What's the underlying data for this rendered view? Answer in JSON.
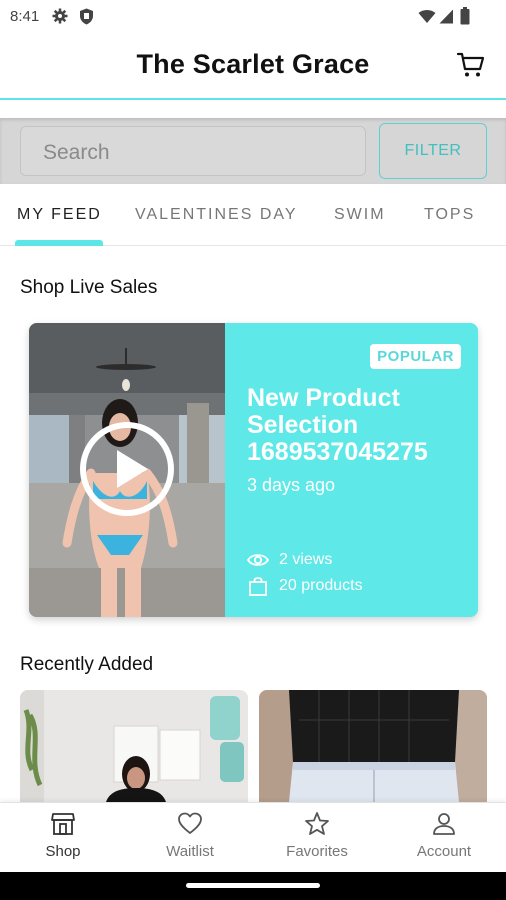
{
  "status_bar": {
    "time": "8:41"
  },
  "app": {
    "title": "The Scarlet Grace"
  },
  "search": {
    "placeholder": "Search",
    "filter_label": "FILTER"
  },
  "tabs": [
    {
      "label": "MY FEED",
      "active": true
    },
    {
      "label": "VALENTINES DAY",
      "active": false
    },
    {
      "label": "SWIM",
      "active": false
    },
    {
      "label": "TOPS",
      "active": false
    }
  ],
  "live_section": {
    "title": "Shop Live Sales",
    "card": {
      "badge": "POPULAR",
      "title": "New Product Selection 1689537045275",
      "time": "3 days ago",
      "views": "2 views",
      "products": "20 products"
    }
  },
  "recent_section": {
    "title": "Recently Added"
  },
  "bottom_nav": [
    {
      "label": "Shop",
      "icon": "shop-icon",
      "active": true
    },
    {
      "label": "Waitlist",
      "icon": "heart-icon",
      "active": false
    },
    {
      "label": "Favorites",
      "icon": "star-icon",
      "active": false
    },
    {
      "label": "Account",
      "icon": "account-icon",
      "active": false
    }
  ],
  "colors": {
    "accent": "#5ee8e8",
    "filter_text": "#43bfbf",
    "badge_text": "#5ad8d8"
  }
}
